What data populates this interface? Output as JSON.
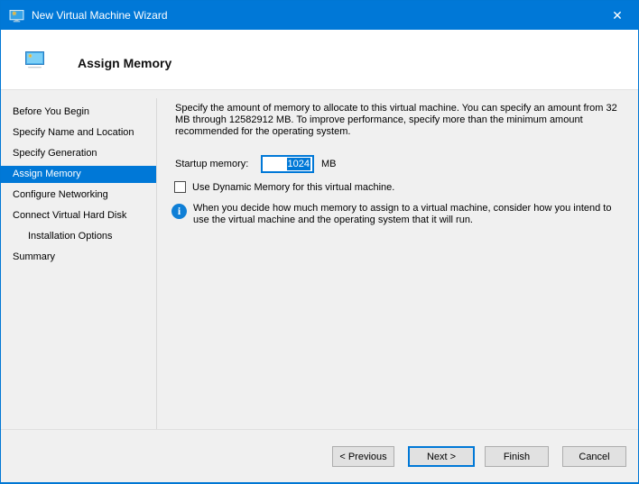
{
  "titlebar": {
    "title": "New Virtual Machine Wizard"
  },
  "header": {
    "title": "Assign Memory"
  },
  "sidebar": {
    "items": [
      {
        "label": "Before You Begin",
        "selected": false,
        "indent": false
      },
      {
        "label": "Specify Name and Location",
        "selected": false,
        "indent": false
      },
      {
        "label": "Specify Generation",
        "selected": false,
        "indent": false
      },
      {
        "label": "Assign Memory",
        "selected": true,
        "indent": false
      },
      {
        "label": "Configure Networking",
        "selected": false,
        "indent": false
      },
      {
        "label": "Connect Virtual Hard Disk",
        "selected": false,
        "indent": false
      },
      {
        "label": "Installation Options",
        "selected": false,
        "indent": true
      },
      {
        "label": "Summary",
        "selected": false,
        "indent": false
      }
    ]
  },
  "content": {
    "description": "Specify the amount of memory to allocate to this virtual machine. You can specify an amount from 32 MB through 12582912 MB. To improve performance, specify more than the minimum amount recommended for the operating system.",
    "startup_memory": {
      "label": "Startup memory:",
      "value": "1024",
      "unit": "MB",
      "value_selected": true
    },
    "dynamic_memory": {
      "label": "Use Dynamic Memory for this virtual machine.",
      "checked": false
    },
    "info_note": "When you decide how much memory to assign to a virtual machine, consider how you intend to use the virtual machine and the operating system that it will run."
  },
  "footer": {
    "buttons": [
      {
        "label": "< Previous",
        "default": false
      },
      {
        "label": "Next >",
        "default": true
      },
      {
        "label": "Finish",
        "default": false
      },
      {
        "label": "Cancel",
        "default": false
      }
    ]
  },
  "icons": {
    "app": "vm-monitor-icon",
    "close": "✕",
    "info": "i"
  },
  "colors": {
    "accent": "#0078d7",
    "titlebar_bg": "#0078d7",
    "window_bg": "#f0f0f0",
    "header_bg": "#ffffff",
    "selected_item_bg": "#0078d7",
    "selection_highlight": "#0078d7",
    "button_bg": "#e1e1e1",
    "button_border": "#adadad"
  }
}
